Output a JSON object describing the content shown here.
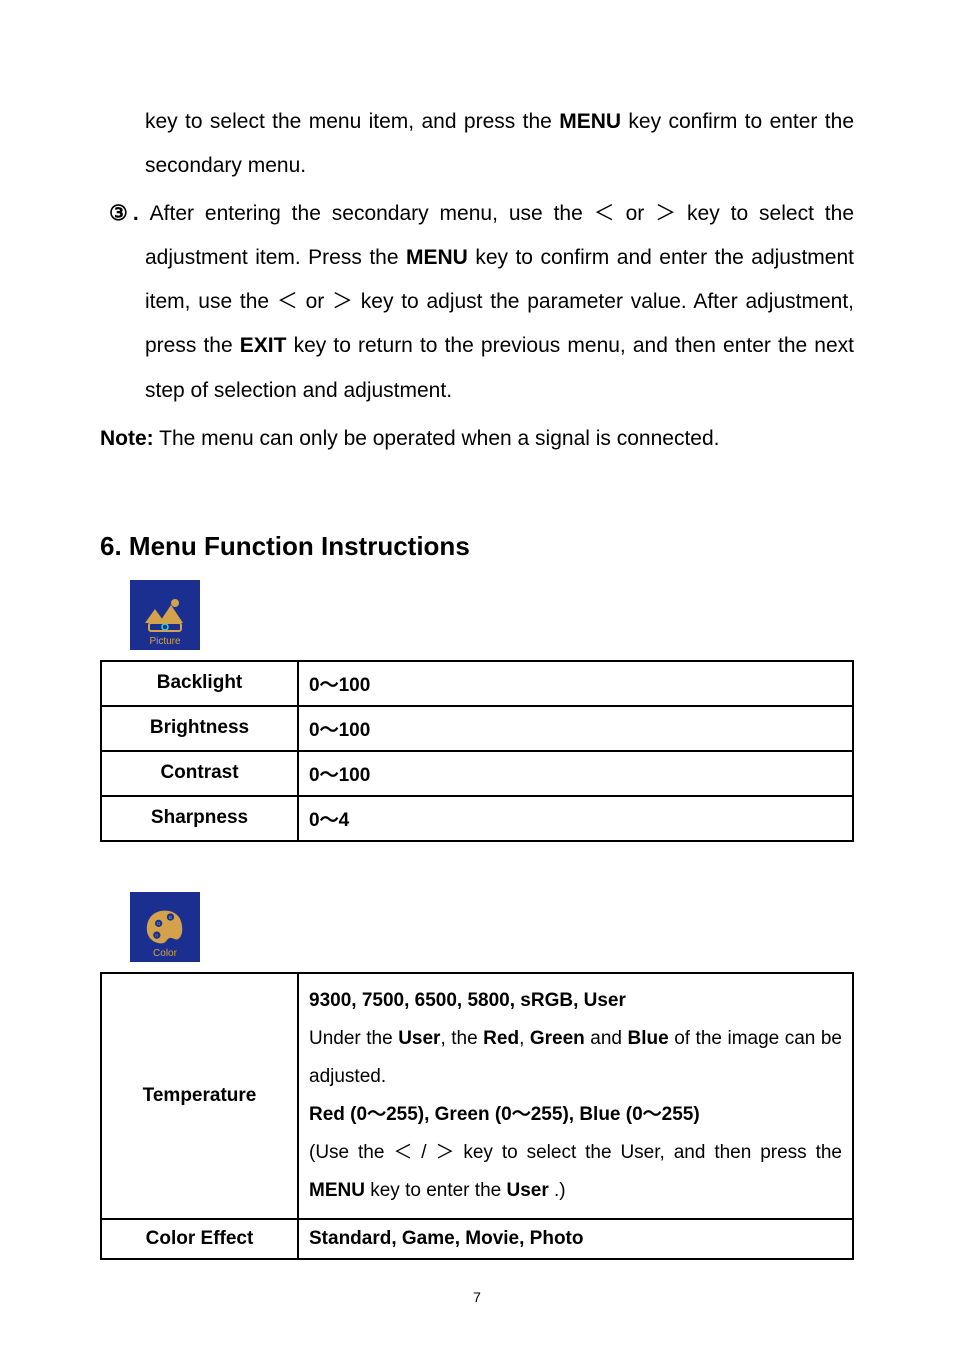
{
  "intro": {
    "cont_line": "key to select the menu item, and press the ",
    "menu_k": "MENU",
    "cont_line2": " key confirm to enter the secondary menu.",
    "step3_marker": "③. ",
    "step3_a": "After entering the secondary menu, use the ＜ or ＞ key to select the adjustment item. Press the ",
    "step3_b": " key to confirm and enter the adjustment item, use the ＜ or ＞ key to adjust the parameter value. After adjustment, press the ",
    "exit_k": "EXIT",
    "step3_c": " key to return to the previous menu, and then enter the next step of selection and adjustment.",
    "note_label": "Note:",
    "note_text": " The menu can only be operated when a signal is connected."
  },
  "heading": "6. Menu Function Instructions",
  "icons": {
    "picture": "Picture",
    "color": "Color"
  },
  "tablePicture": {
    "rows": [
      {
        "param": "Backlight",
        "val": "0～100"
      },
      {
        "param": "Brightness",
        "val": "0～100"
      },
      {
        "param": "Contrast",
        "val": "0～100"
      },
      {
        "param": "Sharpness",
        "val": "0～4"
      }
    ]
  },
  "tableColor": {
    "temp": {
      "label": "Temperature",
      "line1": "9300, 7500, 6500, 5800, sRGB, User",
      "line2_a": "Under the ",
      "user": "User",
      "line2_b": ", the ",
      "red": "Red",
      "comma_sp": ", ",
      "green": "Green",
      "and": " and ",
      "blue": "Blue",
      "line2_c": " of the image can be adjusted.",
      "line3": "Red (0～255), Green (0～255), Blue (0～255)",
      "line4_a": "(Use the ＜ / ＞ key to select the User, and then press the ",
      "menu_k": "MENU",
      "line4_b": " key to enter the ",
      "line4_c": " .)"
    },
    "effect": {
      "label": "Color Effect",
      "val": "Standard, Game, Movie, Photo"
    }
  },
  "pageNumber": "7"
}
